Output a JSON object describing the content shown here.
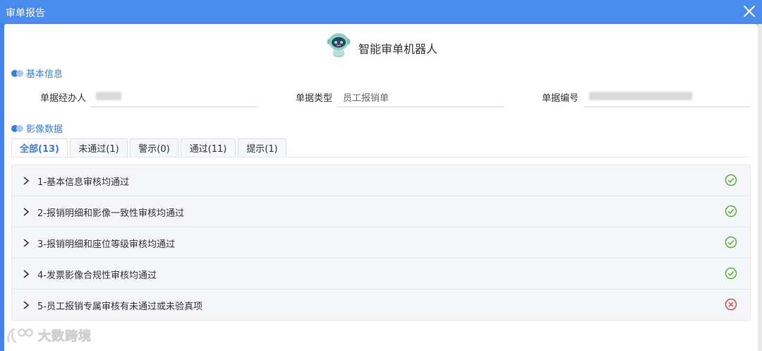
{
  "window": {
    "title": "审单报告",
    "close_icon": "close-icon"
  },
  "robot": {
    "title": "智能审单机器人",
    "icon": "robot-icon"
  },
  "basic_info": {
    "section_title": "基本信息",
    "fields": [
      {
        "label": "单据经办人",
        "value": ""
      },
      {
        "label": "单据类型",
        "value": "员工报销单"
      },
      {
        "label": "单据编号",
        "value": ""
      }
    ]
  },
  "image_data": {
    "section_title": "影像数据",
    "tabs": [
      {
        "label": "全部(13)",
        "active": true
      },
      {
        "label": "未通过(1)",
        "active": false
      },
      {
        "label": "警示(0)",
        "active": false
      },
      {
        "label": "通过(11)",
        "active": false
      },
      {
        "label": "提示(1)",
        "active": false
      }
    ],
    "items": [
      {
        "label": "1-基本信息审核均通过",
        "status": "pass"
      },
      {
        "label": "2-报销明细和影像一致性审核均通过",
        "status": "pass"
      },
      {
        "label": "3-报销明细和座位等级审核均通过",
        "status": "pass"
      },
      {
        "label": "4-发票影像合规性审核均通过",
        "status": "pass"
      },
      {
        "label": "5-员工报销专属审核有未通过或未验真项",
        "status": "fail"
      }
    ]
  },
  "colors": {
    "accent": "#3a7de0",
    "titlebar": "#4a8bee",
    "pass": "#5cb338",
    "fail": "#e5484d"
  },
  "watermark": {
    "text": "大数跨境"
  }
}
